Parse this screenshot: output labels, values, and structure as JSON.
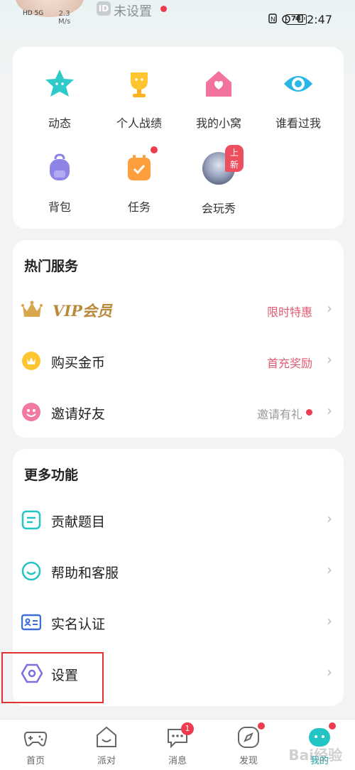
{
  "status_bar": {
    "network_left": "HD 5G",
    "speed_value": "2.3",
    "speed_unit": "M/s",
    "nickname_badge": "ID",
    "nickname": "未设置",
    "battery": "78",
    "time": "2:47"
  },
  "grid": [
    {
      "label": "动态",
      "icon": "star-icon",
      "color": "#2ec9c9"
    },
    {
      "label": "个人战绩",
      "icon": "trophy-icon",
      "color": "#ffc531"
    },
    {
      "label": "我的小窝",
      "icon": "house-icon",
      "color": "#f1729a"
    },
    {
      "label": "谁看过我",
      "icon": "eye-icon",
      "color": "#2ab7e8"
    },
    {
      "label": "背包",
      "icon": "backpack-icon",
      "color": "#8d84e6"
    },
    {
      "label": "任务",
      "icon": "task-icon",
      "color": "#ff9e3d"
    },
    {
      "label": "会玩秀",
      "icon": "avatar-show-icon",
      "color": "#4a5a7a",
      "badge": "上新"
    }
  ],
  "services": {
    "title": "热门服务",
    "items": [
      {
        "label": "VIP会员",
        "right": "限时特惠",
        "icon": "crown-icon"
      },
      {
        "label": "购买金币",
        "right": "首充奖励",
        "icon": "coin-icon"
      },
      {
        "label": "邀请好友",
        "right": "邀请有礼",
        "icon": "smile-face-icon"
      }
    ]
  },
  "more": {
    "title": "更多功能",
    "items": [
      {
        "label": "贡献题目",
        "icon": "document-icon"
      },
      {
        "label": "帮助和客服",
        "icon": "headset-icon"
      },
      {
        "label": "实名认证",
        "icon": "id-card-icon"
      },
      {
        "label": "设置",
        "icon": "hexagon-settings-icon"
      }
    ]
  },
  "nav": [
    {
      "label": "首页",
      "icon": "gamepad-icon"
    },
    {
      "label": "派对",
      "icon": "party-house-icon"
    },
    {
      "label": "消息",
      "icon": "chat-bubble-icon",
      "badge": "1"
    },
    {
      "label": "发现",
      "icon": "compass-icon"
    },
    {
      "label": "我的",
      "icon": "profile-face-icon"
    }
  ],
  "colors": {
    "accent": "#22c4c4",
    "promo": "#e05a72",
    "danger": "#ee3b4e",
    "vip_gold": "#b98a3a"
  }
}
